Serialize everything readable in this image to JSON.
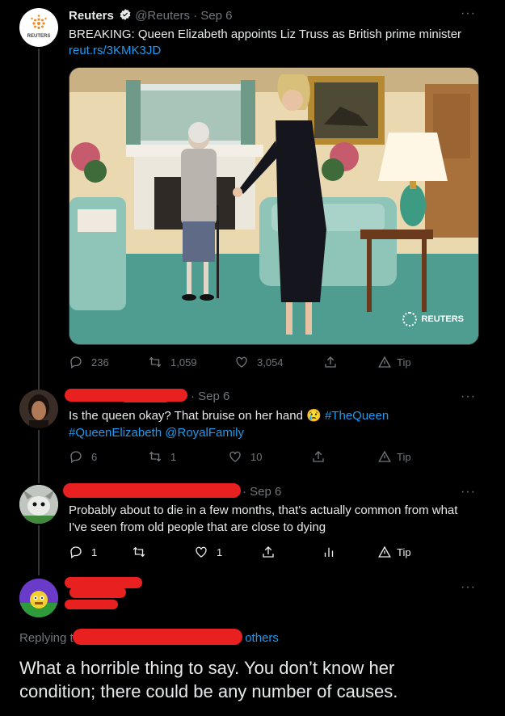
{
  "tweet1": {
    "author_name": "Reuters",
    "handle": "@Reuters",
    "date": "· Sep 6",
    "text": "BREAKING: Queen Elizabeth appoints Liz Truss as British prime minister",
    "link": "reut.rs/3KMK3JD",
    "avatar_text": "REUTERS",
    "media_watermark": "REUTERS",
    "replies": "236",
    "retweets": "1,059",
    "likes": "3,054",
    "tip": "Tip"
  },
  "tweet2": {
    "date": "· Sep 6",
    "text_plain": "Is the queen okay? That bruise on her hand",
    "emoji": "😢",
    "hashtag1": "#TheQueen",
    "hashtag2": "#QueenElizabeth",
    "mention": "@RoyalFamily",
    "replies": "6",
    "retweets": "1",
    "likes": "10",
    "tip": "Tip"
  },
  "tweet3": {
    "date": "· Sep 6",
    "text": "Probably about to die in a few months, that's actually common from what I've seen from old people that are close to dying",
    "replies": "1",
    "retweets": "",
    "likes": "1",
    "tip": "Tip"
  },
  "tweet4": {
    "replying_prefix": "Replying t",
    "replying_suffix": "2 others",
    "text": "What a horrible thing to say. You don’t know her condition; there could be any number of causes."
  },
  "more_label": "···",
  "colors": {
    "accent": "#1d9bf0",
    "redaction": "#e8201f",
    "muted": "#71767b",
    "background": "#000000"
  }
}
